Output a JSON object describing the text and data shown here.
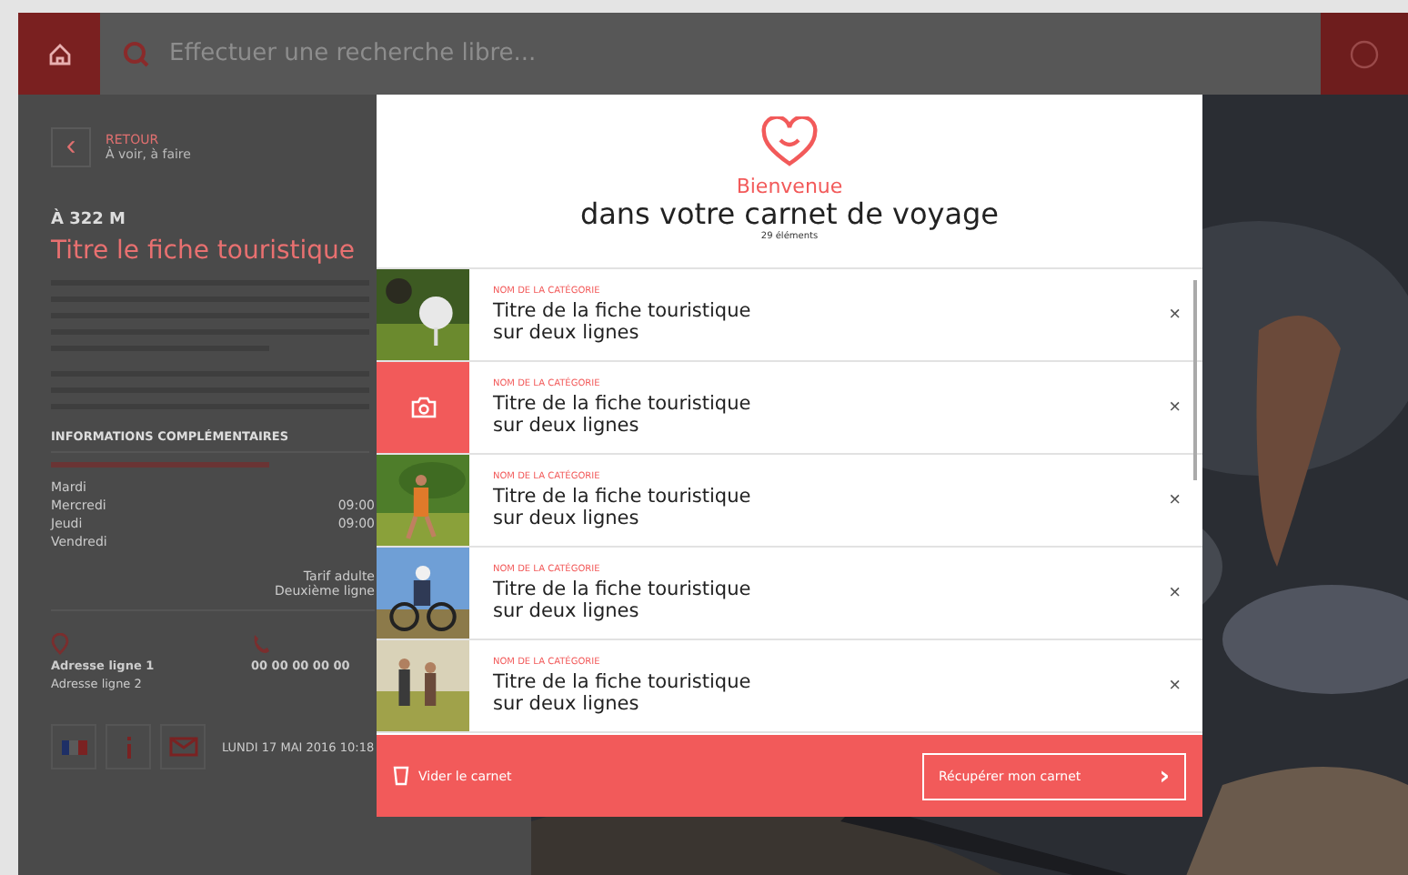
{
  "header": {
    "search_placeholder": "Effectuer une recherche libre..."
  },
  "back": {
    "arrow": "‹",
    "label": "RETOUR",
    "sublabel": "À voir, à faire"
  },
  "poi": {
    "distance": "À 322 M",
    "title": "Titre le fiche touristique"
  },
  "info": {
    "heading": "INFORMATIONS COMPLÉMENTAIRES",
    "days": [
      {
        "day": "Mardi"
      },
      {
        "day": "Mercredi",
        "hours": "09:00"
      },
      {
        "day": "Jeudi",
        "hours": "09:00"
      },
      {
        "day": "Vendredi"
      }
    ],
    "tariff": [
      "Tarif adulte",
      "Deuxième ligne"
    ],
    "address": [
      "Adresse ligne 1",
      "Adresse ligne 2"
    ],
    "phone": "00 00 00 00 00"
  },
  "footer_date": "LUNDI 17 MAI 2016 10:18",
  "modal": {
    "welcome": "Bienvenue",
    "title": "dans votre carnet de voyage",
    "count": "29 éléments",
    "items": [
      {
        "category": "NOM DE LA CATÉGORIE",
        "title": "Titre de la fiche touristique",
        "subtitle": "sur deux lignes",
        "close": "×"
      },
      {
        "kind": "icon",
        "category": "NOM DE LA CATÉGORIE",
        "title": "Titre de la fiche touristique",
        "subtitle": "sur deux lignes",
        "close": "×"
      },
      {
        "category": "NOM DE LA CATÉGORIE",
        "title": "Titre de la fiche touristique",
        "subtitle": "sur deux lignes",
        "close": "×"
      },
      {
        "category": "NOM DE LA CATÉGORIE",
        "title": "Titre de la fiche touristique",
        "subtitle": "sur deux lignes",
        "close": "×"
      },
      {
        "category": "NOM DE LA CATÉGORIE",
        "title": "Titre de la fiche touristique",
        "subtitle": "sur deux lignes",
        "close": "×"
      }
    ],
    "clear_label": "Vider le carnet",
    "retrieve_label": "Récupérer mon carnet",
    "retrieve_arrow": "›"
  }
}
